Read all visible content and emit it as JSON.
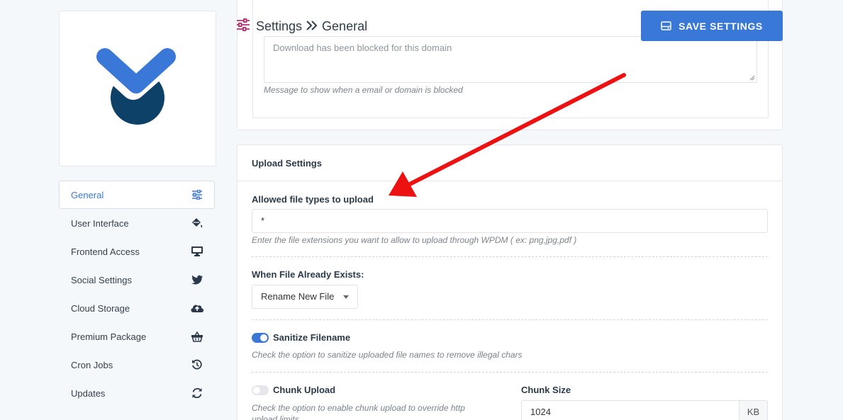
{
  "header": {
    "breadcrumb": [
      "Settings",
      "General"
    ],
    "save_label": "SAVE SETTINGS"
  },
  "sidebar": {
    "items": [
      {
        "label": "General",
        "icon": "sliders-icon",
        "active": true
      },
      {
        "label": "User Interface",
        "icon": "paint-bucket-icon"
      },
      {
        "label": "Frontend Access",
        "icon": "monitor-icon"
      },
      {
        "label": "Social Settings",
        "icon": "twitter-icon"
      },
      {
        "label": "Cloud Storage",
        "icon": "cloud-upload-icon"
      },
      {
        "label": "Premium Package",
        "icon": "basket-icon"
      },
      {
        "label": "Cron Jobs",
        "icon": "history-icon"
      },
      {
        "label": "Updates",
        "icon": "sync-icon"
      }
    ]
  },
  "blocked": {
    "placeholder": "Download has been blocked for this domain",
    "help": "Message to show when a email or domain is blocked"
  },
  "upload": {
    "title": "Upload Settings",
    "allowed_label": "Allowed file types to upload",
    "allowed_value": "*",
    "allowed_help": "Enter the file extensions you want to allow to upload through WPDM ( ex: png,jpg,pdf )",
    "exists_label": "When File Already Exists:",
    "exists_value": "Rename New File",
    "sanitize_label": "Sanitize Filename",
    "sanitize_on": true,
    "sanitize_help": "Check the option to sanitize uploaded file names to remove illegal chars",
    "chunk_label": "Chunk Upload",
    "chunk_on": false,
    "chunk_help": "Check the option to enable chunk upload to override http upload limits",
    "chunk_size_label": "Chunk Size",
    "chunk_size_value": "1024",
    "chunk_size_unit": "KB"
  },
  "colors": {
    "accent": "#3a78d8",
    "logo_dark": "#0e4168",
    "arrow": "#ee1111",
    "header_icon": "#b0306f"
  }
}
